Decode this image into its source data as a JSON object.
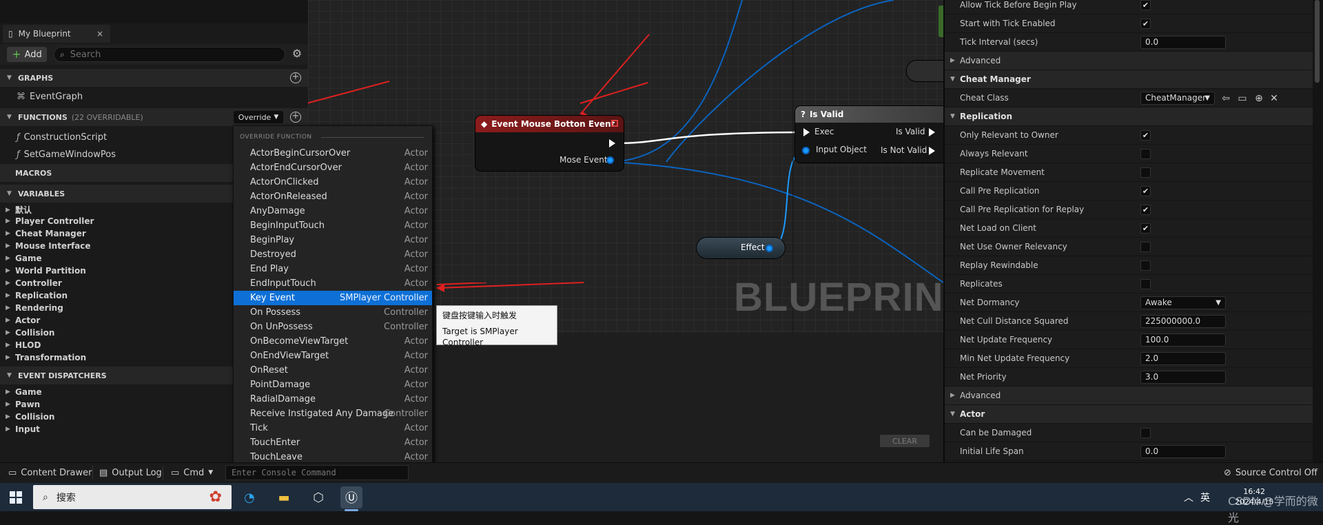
{
  "left_panel": {
    "tab_title": "My Blueprint",
    "tab_close": "×",
    "add_label": "Add",
    "search_placeholder": "Search",
    "sections": {
      "graphs": "GRAPHS",
      "functions": "FUNCTIONS",
      "functions_count": "(22 OVERRIDABLE)",
      "macros": "MACROS",
      "variables": "VARIABLES",
      "event_dispatchers": "EVENT DISPATCHERS"
    },
    "graphs": [
      "EventGraph"
    ],
    "functions": [
      "ConstructionScript",
      "SetGameWindowPos"
    ],
    "override_label": "Override",
    "variable_categories": [
      "默认",
      "Player Controller",
      "Cheat Manager",
      "Mouse Interface",
      "Game",
      "World Partition",
      "Controller",
      "Replication",
      "Rendering",
      "Actor",
      "Collision",
      "HLOD",
      "Transformation"
    ],
    "dispatcher_categories": [
      "Game",
      "Pawn",
      "Collision",
      "Input"
    ]
  },
  "override_menu": {
    "header": "OVERRIDE FUNCTION",
    "items": [
      {
        "name": "ActorBeginCursorOver",
        "type": "Actor"
      },
      {
        "name": "ActorEndCursorOver",
        "type": "Actor"
      },
      {
        "name": "ActorOnClicked",
        "type": "Actor"
      },
      {
        "name": "ActorOnReleased",
        "type": "Actor"
      },
      {
        "name": "AnyDamage",
        "type": "Actor"
      },
      {
        "name": "BeginInputTouch",
        "type": "Actor"
      },
      {
        "name": "BeginPlay",
        "type": "Actor"
      },
      {
        "name": "Destroyed",
        "type": "Actor"
      },
      {
        "name": "End Play",
        "type": "Actor"
      },
      {
        "name": "EndInputTouch",
        "type": "Actor"
      },
      {
        "name": "Key Event",
        "type": "SMPlayer Controller"
      },
      {
        "name": "On Possess",
        "type": "Controller"
      },
      {
        "name": "On UnPossess",
        "type": "Controller"
      },
      {
        "name": "OnBecomeViewTarget",
        "type": "Actor"
      },
      {
        "name": "OnEndViewTarget",
        "type": "Actor"
      },
      {
        "name": "OnReset",
        "type": "Actor"
      },
      {
        "name": "PointDamage",
        "type": "Actor"
      },
      {
        "name": "RadialDamage",
        "type": "Actor"
      },
      {
        "name": "Receive Instigated Any Damage",
        "type": "Controller"
      },
      {
        "name": "Tick",
        "type": "Actor"
      },
      {
        "name": "TouchEnter",
        "type": "Actor"
      },
      {
        "name": "TouchLeave",
        "type": "Actor"
      }
    ],
    "selected_index": 10,
    "tooltip_line1": "键盘按键输入时触发",
    "tooltip_line2": "Target is SMPlayer Controller"
  },
  "graph": {
    "event_node_title": "Event Mouse Botton Event",
    "event_node_pin": "Mose Event",
    "isvalid_title": "Is Valid",
    "isvalid_in_exec": "Exec",
    "isvalid_in_obj": "Input Object",
    "isvalid_out_valid": "Is Valid",
    "isvalid_out_notvalid": "Is Not Valid",
    "effect_label": "Effect",
    "watermark": "BLUEPRINT",
    "clear_label": "CLEAR"
  },
  "details": {
    "rows": [
      {
        "kind": "check",
        "label": "Allow Tick Before Begin Play",
        "checked": true
      },
      {
        "kind": "check",
        "label": "Start with Tick Enabled",
        "checked": true
      },
      {
        "kind": "num",
        "label": "Tick Interval (secs)",
        "value": "0.0"
      },
      {
        "kind": "sub",
        "label": "Advanced"
      },
      {
        "kind": "cat",
        "label": "Cheat Manager"
      },
      {
        "kind": "class",
        "label": "Cheat Class",
        "value": "CheatManager"
      },
      {
        "kind": "cat",
        "label": "Replication"
      },
      {
        "kind": "check",
        "label": "Only Relevant to Owner",
        "checked": true
      },
      {
        "kind": "check",
        "label": "Always Relevant",
        "checked": false
      },
      {
        "kind": "check",
        "label": "Replicate Movement",
        "checked": false
      },
      {
        "kind": "check",
        "label": "Call Pre Replication",
        "checked": true
      },
      {
        "kind": "check",
        "label": "Call Pre Replication for Replay",
        "checked": true
      },
      {
        "kind": "check",
        "label": "Net Load on Client",
        "checked": true
      },
      {
        "kind": "check",
        "label": "Net Use Owner Relevancy",
        "checked": false
      },
      {
        "kind": "check",
        "label": "Replay Rewindable",
        "checked": false
      },
      {
        "kind": "check",
        "label": "Replicates",
        "checked": false
      },
      {
        "kind": "dd",
        "label": "Net Dormancy",
        "value": "Awake"
      },
      {
        "kind": "num",
        "label": "Net Cull Distance Squared",
        "value": "225000000.0"
      },
      {
        "kind": "num",
        "label": "Net Update Frequency",
        "value": "100.0"
      },
      {
        "kind": "num",
        "label": "Min Net Update Frequency",
        "value": "2.0"
      },
      {
        "kind": "num",
        "label": "Net Priority",
        "value": "3.0"
      },
      {
        "kind": "sub",
        "label": "Advanced"
      },
      {
        "kind": "cat",
        "label": "Actor"
      },
      {
        "kind": "check",
        "label": "Can be Damaged",
        "checked": false
      },
      {
        "kind": "num",
        "label": "Initial Life Span",
        "value": "0.0"
      }
    ]
  },
  "bottom": {
    "content_drawer": "Content Drawer",
    "output_log": "Output Log",
    "cmd": "Cmd",
    "cmd_placeholder": "Enter Console Command",
    "source_control": "Source Control Off"
  },
  "taskbar": {
    "search_label": "搜索",
    "ime": "英",
    "time": "16:42",
    "date": "2024/4/15",
    "watermark": "CSDN @学而的微光"
  },
  "colors": {
    "selection": "#0e70d6",
    "event_node_header": "#8c1c1c",
    "wire_blue": "#0a64c0",
    "accent_red_arrow": "#e02020"
  }
}
